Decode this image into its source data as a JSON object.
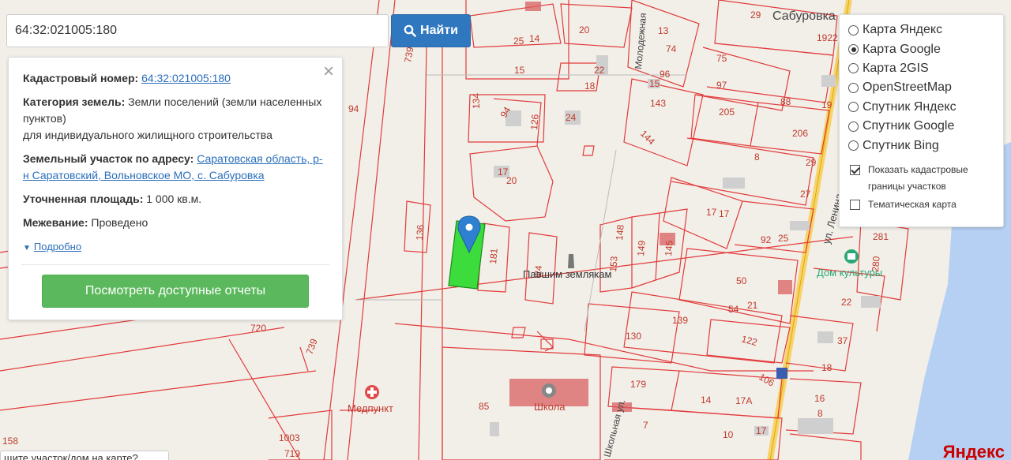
{
  "search": {
    "value": "64:32:021005:180",
    "button_label": "Найти"
  },
  "info": {
    "cad_label": "Кадастровый номер:",
    "cad_number": "64:32:021005:180",
    "cat_label": "Категория земель:",
    "cat_value": "Земли поселений (земли населенных пунктов)",
    "cat_use": "для индивидуального жилищного строительства",
    "addr_label": "Земельный участок по адресу:",
    "addr_value": "Саратовская область, р-н Саратовский, Вольновское МО, с. Сабуровка",
    "area_label": "Уточненная площадь:",
    "area_value": "1 000 кв.м.",
    "survey_label": "Межевание:",
    "survey_value": "Проведено",
    "more_label": "Подробно",
    "reports_label": "Посмотреть доступные отчеты",
    "close_symbol": "×"
  },
  "layers": {
    "options": [
      {
        "label": "Карта Яндекс",
        "selected": false
      },
      {
        "label": "Карта Google",
        "selected": true
      },
      {
        "label": "Карта 2GIS",
        "selected": false
      },
      {
        "label": "OpenStreetMap",
        "selected": false
      },
      {
        "label": "Спутник Яндекс",
        "selected": false
      },
      {
        "label": "Спутник Google",
        "selected": false
      },
      {
        "label": "Спутник Bing",
        "selected": false
      }
    ],
    "show_borders_label": "Показать кадастровые границы участков",
    "show_borders_checked": true,
    "thematic_label": "Тематическая карта",
    "thematic_checked": false
  },
  "map": {
    "parcel_labels": [
      "29",
      "14",
      "25",
      "20",
      "13",
      "74",
      "15",
      "18",
      "22",
      "96",
      "15",
      "75",
      "97",
      "88",
      "134",
      "94",
      "126",
      "24",
      "143",
      "205",
      "206",
      "144",
      "8",
      "17",
      "20",
      "94",
      "136",
      "181",
      "24",
      "148",
      "149",
      "145",
      "153",
      "17",
      "17",
      "92",
      "25",
      "50",
      "54",
      "21",
      "130",
      "139",
      "122",
      "720",
      "739",
      "739",
      "85",
      "179",
      "14",
      "17А",
      "7",
      "10",
      "17",
      "1003",
      "719",
      "158",
      "281",
      "280",
      "22",
      "37",
      "18",
      "16",
      "8",
      "106",
      "1922",
      "19",
      "27",
      "29"
    ],
    "poi_labels": [
      "Павшим землякам",
      "Дом культуры",
      "Медпункт",
      "Школа"
    ],
    "street_labels": [
      "Сабуровка",
      "Молодежная",
      "ул. Ленина",
      "Школьная ул."
    ],
    "highlight_color": "#3ddc3d",
    "line_color": "#e23b3b",
    "road_color": "#f5b800"
  },
  "bottom_hint": "щите участок/дом на карте?",
  "yandex_brand": "Яндекс"
}
